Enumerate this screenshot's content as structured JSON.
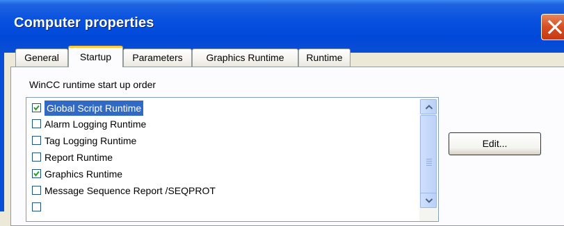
{
  "window": {
    "title": "Computer properties"
  },
  "tabs": [
    {
      "label": "General",
      "active": false
    },
    {
      "label": "Startup",
      "active": true
    },
    {
      "label": "Parameters",
      "active": false
    },
    {
      "label": "Graphics Runtime",
      "active": false
    },
    {
      "label": "Runtime",
      "active": false
    }
  ],
  "startup": {
    "section_label": "WinCC runtime start up order",
    "items": [
      {
        "label": "Global Script Runtime",
        "checked": true,
        "selected": true
      },
      {
        "label": "Alarm Logging Runtime",
        "checked": false
      },
      {
        "label": "Tag Logging Runtime",
        "checked": false
      },
      {
        "label": "Report Runtime",
        "checked": false
      },
      {
        "label": "Graphics Runtime",
        "checked": true
      },
      {
        "label": "Message Sequence Report /SEQPROT",
        "checked": false
      }
    ],
    "edit_label": "Edit..."
  },
  "icons": {
    "close": "close-icon",
    "scroll_up": "chevron-up-icon",
    "scroll_down": "chevron-down-icon",
    "check": "checkmark-icon"
  },
  "colors": {
    "titlebar": "#0a4ed4",
    "close": "#d84d22",
    "selection": "#316ac5",
    "active_tab_accent": "#ffc83c"
  }
}
